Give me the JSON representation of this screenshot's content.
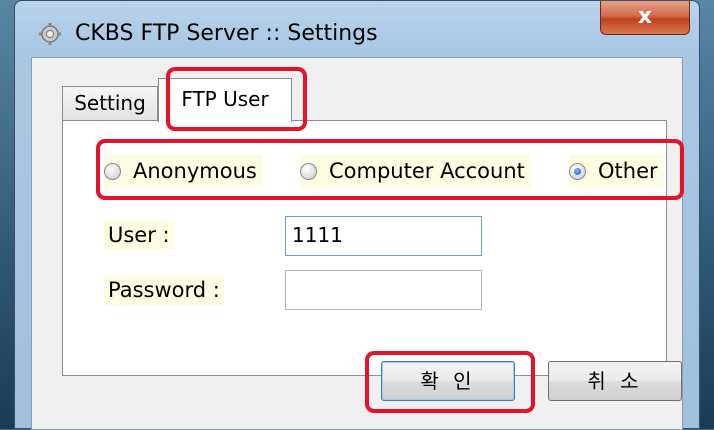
{
  "window": {
    "title": "CKBS FTP Server :: Settings",
    "close_label": "x"
  },
  "tabs": [
    {
      "label": "Setting",
      "active": false
    },
    {
      "label": "FTP User",
      "active": true
    }
  ],
  "auth_options": [
    {
      "label": "Anonymous",
      "selected": false
    },
    {
      "label": "Computer Account",
      "selected": false
    },
    {
      "label": "Other",
      "selected": true
    }
  ],
  "form": {
    "user_label": "User :",
    "user_value": "1111",
    "password_label": "Password :",
    "password_value": ""
  },
  "buttons": {
    "ok_label": "확 인",
    "cancel_label": "취 소"
  },
  "colors": {
    "highlight": "#e4132a",
    "label_background": "#fdfde3"
  }
}
